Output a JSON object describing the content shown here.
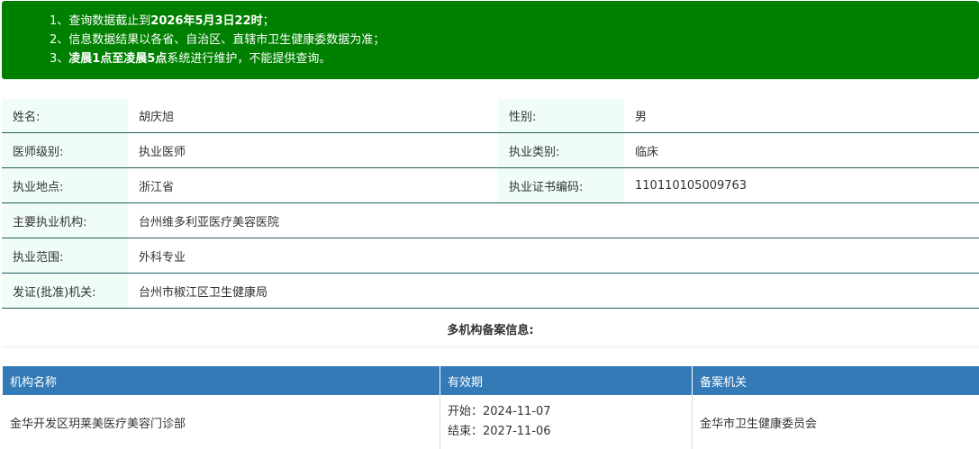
{
  "notice": {
    "line1_prefix": "1、查询数据截止到",
    "line1_bold": "2026年5月3日22时",
    "line1_suffix": "；",
    "line2": "2、信息数据结果以各省、自治区、直辖市卫生健康委数据为准；",
    "line3_prefix": "3、",
    "line3_bold": "凌晨1点至凌晨5点",
    "line3_suffix": "系统进行维护，不能提供查询。"
  },
  "info": {
    "name_label": "姓名:",
    "name_value": "胡庆旭",
    "gender_label": "性别:",
    "gender_value": "男",
    "level_label": "医师级别:",
    "level_value": "执业医师",
    "category_label": "执业类别:",
    "category_value": "临床",
    "location_label": "执业地点:",
    "location_value": "浙江省",
    "cert_label": "执业证书编码:",
    "cert_value": "110110105009763",
    "org_label": "主要执业机构:",
    "org_value": "台州维多利亚医疗美容医院",
    "scope_label": "执业范围:",
    "scope_value": "外科专业",
    "issuer_label": "发证(批准)机关:",
    "issuer_value": "台州市椒江区卫生健康局"
  },
  "multi_title": "多机构备案信息:",
  "table": {
    "headers": [
      "机构名称",
      "有效期",
      "备案机关"
    ],
    "rows": [
      {
        "org": "金华开发区玥莱美医疗美容门诊部",
        "start": "开始：2024-11-07",
        "end": "结束：2027-11-06",
        "authority": "金华市卫生健康委员会"
      }
    ]
  }
}
